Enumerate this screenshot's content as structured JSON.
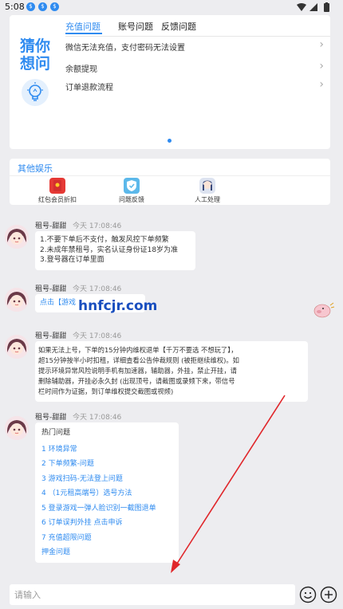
{
  "status_bar": {
    "time": "5:08",
    "notification_icons": [
      "$",
      "$",
      "$"
    ]
  },
  "faq": {
    "guess_label_line1": "猜你",
    "guess_label_line2": "想问",
    "tabs": [
      "充值问题",
      "账号问题",
      "反馈问题"
    ],
    "active_tab": 0,
    "items": [
      "微信无法充值，支付密码无法设置",
      "余额提现",
      "订单退款流程"
    ]
  },
  "other": {
    "title": "其他娱乐",
    "items": [
      {
        "label": "红包会员折扣",
        "icon": "red-packet-icon"
      },
      {
        "label": "问题反馈",
        "icon": "feedback-icon"
      },
      {
        "label": "人工处理",
        "icon": "agent-avatar-icon"
      }
    ]
  },
  "messages": [
    {
      "name": "租号-甜甜",
      "time": "今天 17:08:46",
      "lines": [
        "1.不要下单后不支付，触发风控下单频繁",
        "2.未成年禁租号，实名认证身份证18岁为准",
        "3.登号器在订单里面"
      ]
    },
    {
      "name": "租号-甜甜",
      "time": "今天 17:08:46",
      "lines": [
        "点击【游戏"
      ]
    },
    {
      "name": "租号-甜甜",
      "time": "今天 17:08:46",
      "lines": [
        "如果无法上号，下单的15分钟内维权退单【千万不要选 不想玩了】，",
        "超15分钟按半小时扣租，详细查看公告仲裁规则 (被拒继续维权)。如",
        "提示环境异常风险说明手机有加速器，辅助器，外挂，禁止开挂，请",
        "删除辅助器，开挂必永久封 (出现顶号，请截图或录频下来，带信号",
        "栏时间作为证据，到订单维权提交截图或视频)"
      ]
    },
    {
      "name": "租号-甜甜",
      "time": "今天 17:08:46",
      "hot_title": "热门问题",
      "hot_items": [
        "1 环境异常",
        "2 下单频繁-问题",
        "3 游戏扫码-无法登上问题",
        "4 （1元租高端号）选号方法",
        "5 登录游戏一弹人脸识别一截图退单",
        "6 订单误判外挂 点击申诉",
        "7 充值超限问题",
        "押金问题"
      ]
    }
  ],
  "watermark": "hnfcjr.com",
  "input": {
    "placeholder": "请输入"
  },
  "colors": {
    "accent": "#2f8bf0",
    "background": "#ededf0",
    "arrow": "#e0262a"
  }
}
